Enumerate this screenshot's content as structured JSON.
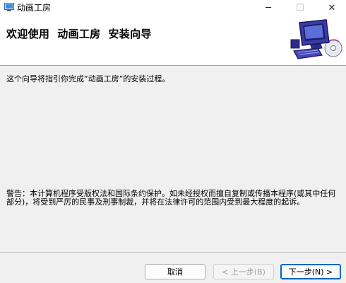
{
  "window": {
    "title": "动画工房",
    "app_icon": "installer-icon",
    "controls": {
      "minimize": "─",
      "maximize": "☐",
      "close": "✕"
    }
  },
  "header": {
    "title": "欢迎使用  动画工房  安装向导",
    "graphic": "computer-cd-icon"
  },
  "body": {
    "description": "这个向导将指引你完成“动画工房”的安装过程。",
    "warning": "警告：本计算机程序受版权法和国际条约保护。如未经授权而擅自复制或传播本程序(或其中任何部分)，将受到严厉的民事及刑事制裁，并将在法律许可的范围内受到最大程度的起诉。"
  },
  "buttons": {
    "cancel": "取消",
    "back": "< 上一步(B)",
    "next": "下一步(N) >"
  },
  "colors": {
    "accent": "#0067c0",
    "header_bg": "#ffffff",
    "dialog_bg": "#f0f0f0"
  }
}
